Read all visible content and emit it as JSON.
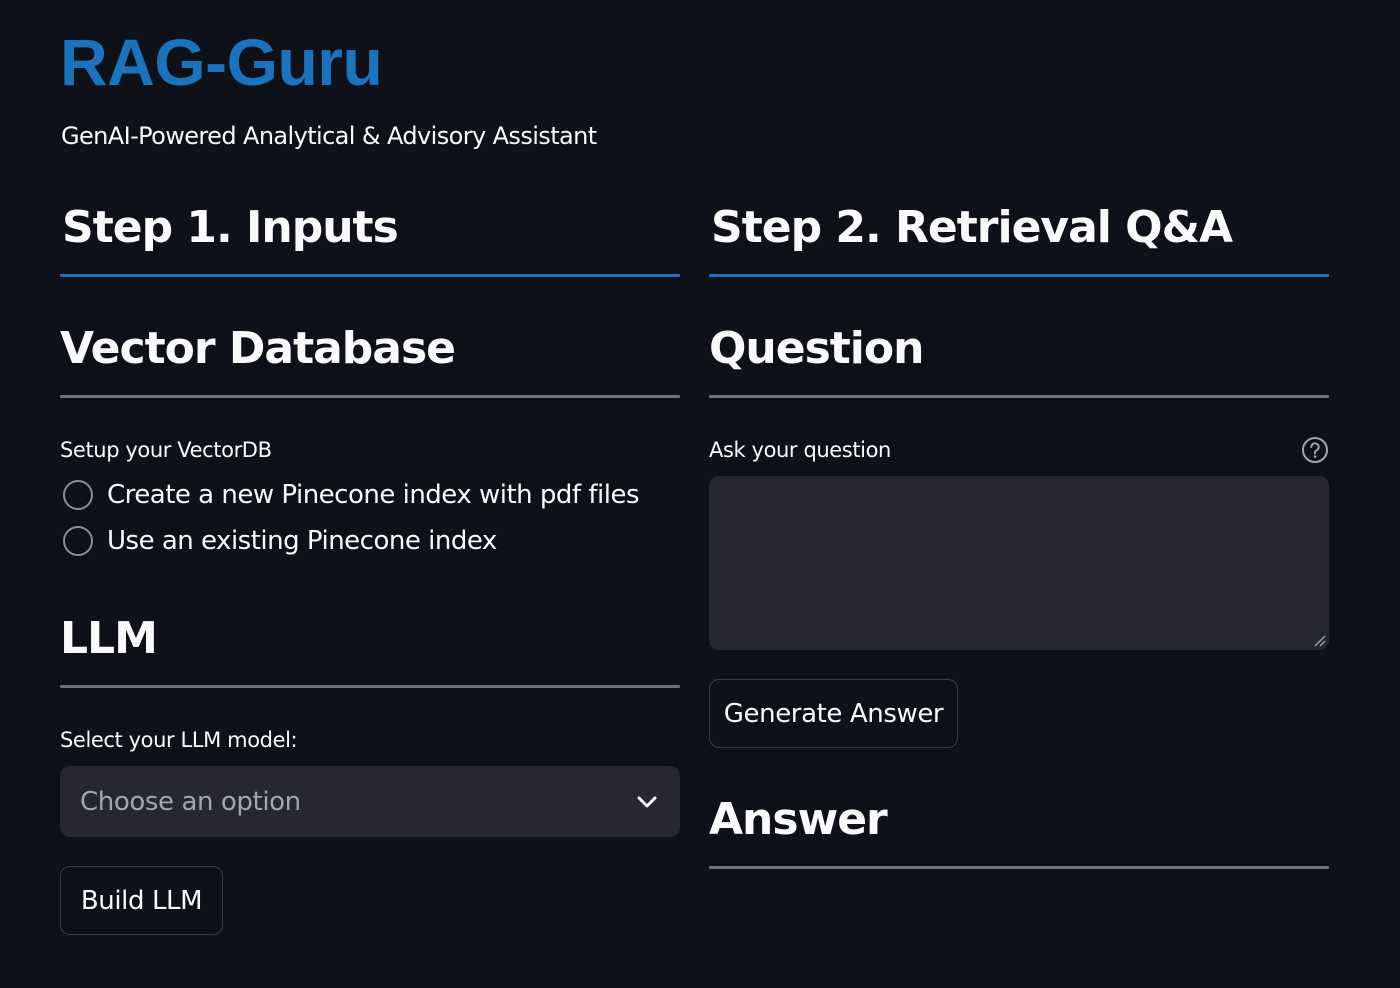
{
  "header": {
    "title": "RAG-Guru",
    "subtitle": "GenAI-Powered Analytical & Advisory Assistant"
  },
  "step1": {
    "heading": "Step 1. Inputs",
    "vector_db": {
      "heading": "Vector Database",
      "label": "Setup your VectorDB",
      "options": [
        {
          "label": "Create a new Pinecone index with pdf files",
          "selected": false
        },
        {
          "label": "Use an existing Pinecone index",
          "selected": false
        }
      ]
    },
    "llm": {
      "heading": "LLM",
      "label": "Select your LLM model:",
      "select_placeholder": "Choose an option",
      "build_button": "Build LLM"
    }
  },
  "step2": {
    "heading": "Step 2. Retrieval Q&A",
    "question": {
      "heading": "Question",
      "label": "Ask your question",
      "value": "",
      "generate_button": "Generate Answer"
    },
    "answer": {
      "heading": "Answer"
    }
  },
  "colors": {
    "background": "#0e1117",
    "title": "#1a74bd",
    "step_rule": "#1f6fbf",
    "section_rule": "#6e707a",
    "input_bg": "#262730"
  },
  "icons": {
    "help": "help-circle-icon",
    "dropdown": "chevron-down-icon",
    "resize": "resize-grip-icon"
  }
}
